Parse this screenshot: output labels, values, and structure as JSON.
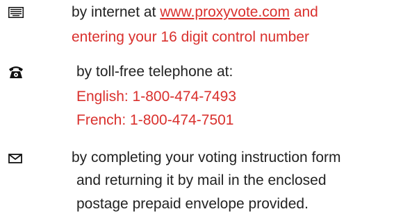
{
  "colors": {
    "text": "#222222",
    "accent": "#d9302d",
    "icon": "#111111"
  },
  "methods": [
    {
      "icon": "keyboard-icon",
      "line1_prefix": "by internet at ",
      "link_text": "www.proxyvote.com",
      "line1_suffix": " and",
      "line2": "entering your 16 digit control number"
    },
    {
      "icon": "telephone-icon",
      "line1": "by toll-free telephone at:",
      "english": "English: 1-800-474-7493",
      "french": "French: 1-800-474-7501"
    },
    {
      "icon": "envelope-icon",
      "line1": "by completing your voting instruction form",
      "line2": "and returning it by mail in the enclosed",
      "line3": "postage prepaid envelope provided."
    }
  ]
}
